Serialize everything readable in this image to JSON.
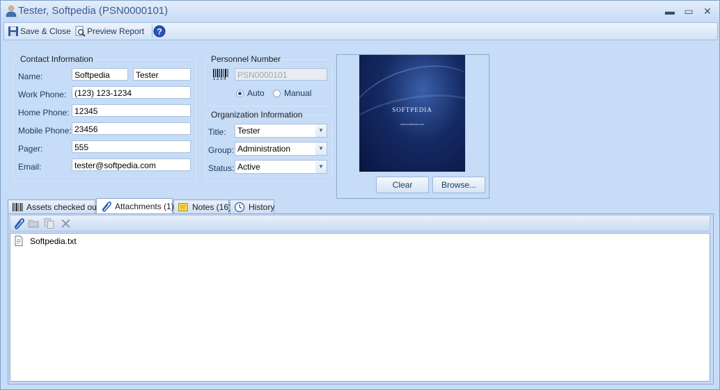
{
  "window": {
    "title": "Tester, Softpedia (PSN0000101)",
    "minimize": "▬",
    "maximize": "▭",
    "close": "✕"
  },
  "toolbar": {
    "save_close": "Save & Close",
    "preview_report": "Preview Report",
    "help_icon": "help-icon"
  },
  "contact": {
    "title": "Contact Information",
    "labels": {
      "name": "Name:",
      "work_phone": "Work Phone:",
      "home_phone": "Home Phone:",
      "mobile_phone": "Mobile Phone:",
      "pager": "Pager:",
      "email": "Email:"
    },
    "values": {
      "first_name": "Softpedia",
      "last_name": "Tester",
      "work_phone": "(123) 123-1234",
      "home_phone": "12345",
      "mobile_phone": "23456",
      "pager": "555",
      "email": "tester@softpedia.com"
    }
  },
  "personnel": {
    "title": "Personnel Number",
    "number": "PSN0000101",
    "barcode_digits": "1 2 3 4",
    "auto": "Auto",
    "manual": "Manual",
    "selected": "Auto"
  },
  "organization": {
    "title": "Organization Information",
    "labels": {
      "title": "Title:",
      "group": "Group:",
      "status": "Status:"
    },
    "values": {
      "title": "Tester",
      "group": "Administration",
      "status": "Active"
    }
  },
  "photo": {
    "brand": "SOFTPEDIA",
    "url": "www.softpedia.com",
    "clear": "Clear",
    "browse": "Browse..."
  },
  "tabs": [
    {
      "label": "Assets checked out",
      "icon": "barcode-icon"
    },
    {
      "label": "Attachments (1)",
      "icon": "paperclip-icon"
    },
    {
      "label": "Notes (16)",
      "icon": "note-icon"
    },
    {
      "label": "History",
      "icon": "clock-icon"
    }
  ],
  "active_tab": "Attachments (1)",
  "attachments": [
    {
      "name": "Softpedia.txt",
      "icon": "text-file-icon"
    }
  ],
  "colors": {
    "window_bg": "#c6dcf7",
    "accent": "#1e395b"
  }
}
